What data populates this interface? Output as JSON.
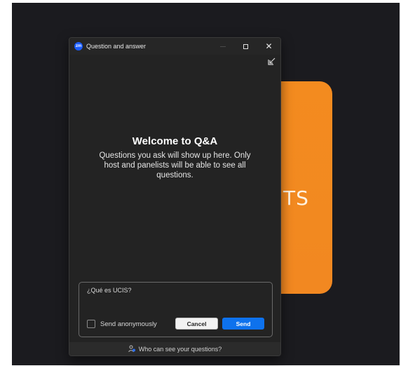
{
  "background": {
    "behind_card_text": "TS",
    "accent_color": "#f38b1f"
  },
  "window": {
    "title": "Question and answer",
    "app_icon_text": "zm",
    "icon_name": "zoom-logo-icon"
  },
  "welcome": {
    "title": "Welcome to Q&A",
    "description": "Questions you ask will show up here. Only host and panelists will be able to see all questions."
  },
  "composer": {
    "value": "¿Qué es UCIS?",
    "anonymous_label": "Send anonymously",
    "anonymous_checked": false,
    "cancel_label": "Cancel",
    "send_label": "Send",
    "send_color": "#0e72ed"
  },
  "footer": {
    "label": "Who can see your questions?",
    "icon_name": "people-icon"
  }
}
